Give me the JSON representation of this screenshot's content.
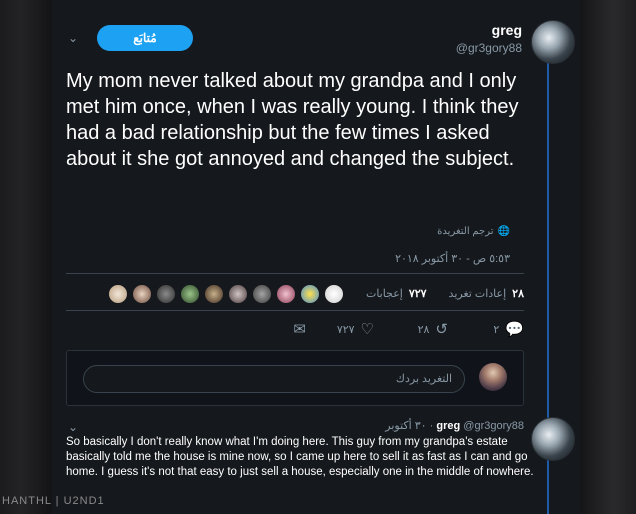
{
  "tweet": {
    "username": "greg",
    "handle": "@gr3gory88",
    "follow_label": "مُتابَع",
    "text": "My mom never talked about my grandpa and I only met him once, when I was really young. I think they had a bad relationship but the few times I asked about it she got annoyed and changed the subject.",
    "translate_label": "ترجم التغريدة",
    "timestamp": "٥:٥٣ ص - ٣٠ أكتوبر ٢٠١٨",
    "retweets_count": "٢٨",
    "retweets_label": "إعادات تغريد",
    "likes_count": "٧٢٧",
    "likes_label": "إعجابات",
    "actions": {
      "reply_count": "٢",
      "retweet_count": "٢٨",
      "like_count": "٧٢٧"
    }
  },
  "reply_box": {
    "placeholder": "التغريد بردك"
  },
  "reply_tweet": {
    "username": "greg",
    "handle": "@gr3gory88",
    "date": "٣٠ أكتوبر",
    "text": "So basically I don't really know what I'm doing here. This guy from my grandpa's estate basically told me the house is mine now, so I came up here to sell it as fast as I can and go home. I guess it's not that easy to just sell a house, especially one in the middle of nowhere."
  },
  "watermark": "HANTHL | U2ND1",
  "colors": {
    "accent": "#1da1f2",
    "background": "#15181c",
    "muted": "#8899a6",
    "thread_line": "#1f5aa8"
  },
  "icons": [
    "chevron-down-icon",
    "globe-icon",
    "reply-icon",
    "retweet-icon",
    "heart-icon",
    "mail-icon"
  ]
}
